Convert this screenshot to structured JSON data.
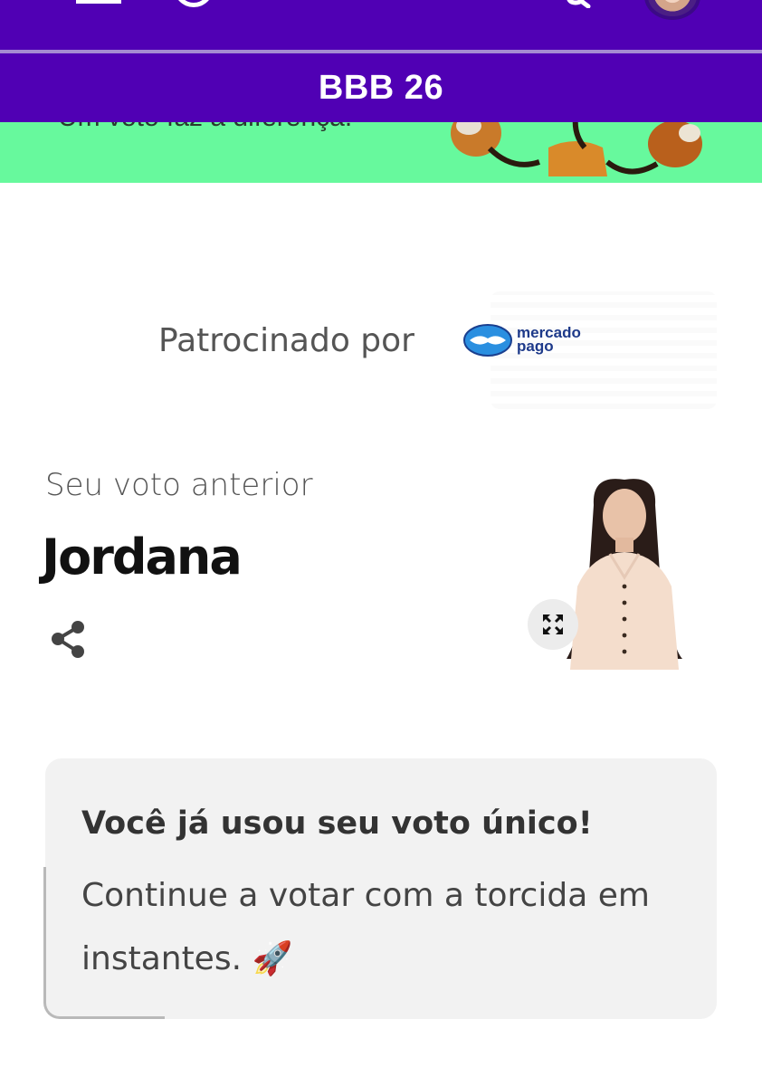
{
  "header": {
    "title": "BBB 26",
    "colors": {
      "bar": "#5000b4",
      "divider": "#a58bd2",
      "hero": "#67f99d"
    },
    "icons": [
      "menu-icon",
      "logo-icon",
      "search-icon",
      "avatar"
    ]
  },
  "hero": {
    "text": "Um voto faz a diferença."
  },
  "sponsor": {
    "label": "Patrocinado por",
    "logo_line1": "mercado",
    "logo_line2": "pago",
    "logo_color": "#1e3a8a"
  },
  "previous_vote": {
    "label": "Seu voto anterior",
    "name": "Jordana",
    "icons": [
      "share-icon",
      "expand-icon"
    ]
  },
  "notice": {
    "title": "Você já usou seu voto único!",
    "body": "Continue a votar com a torcida em instantes. 🚀",
    "background": "#f2f2f2"
  }
}
